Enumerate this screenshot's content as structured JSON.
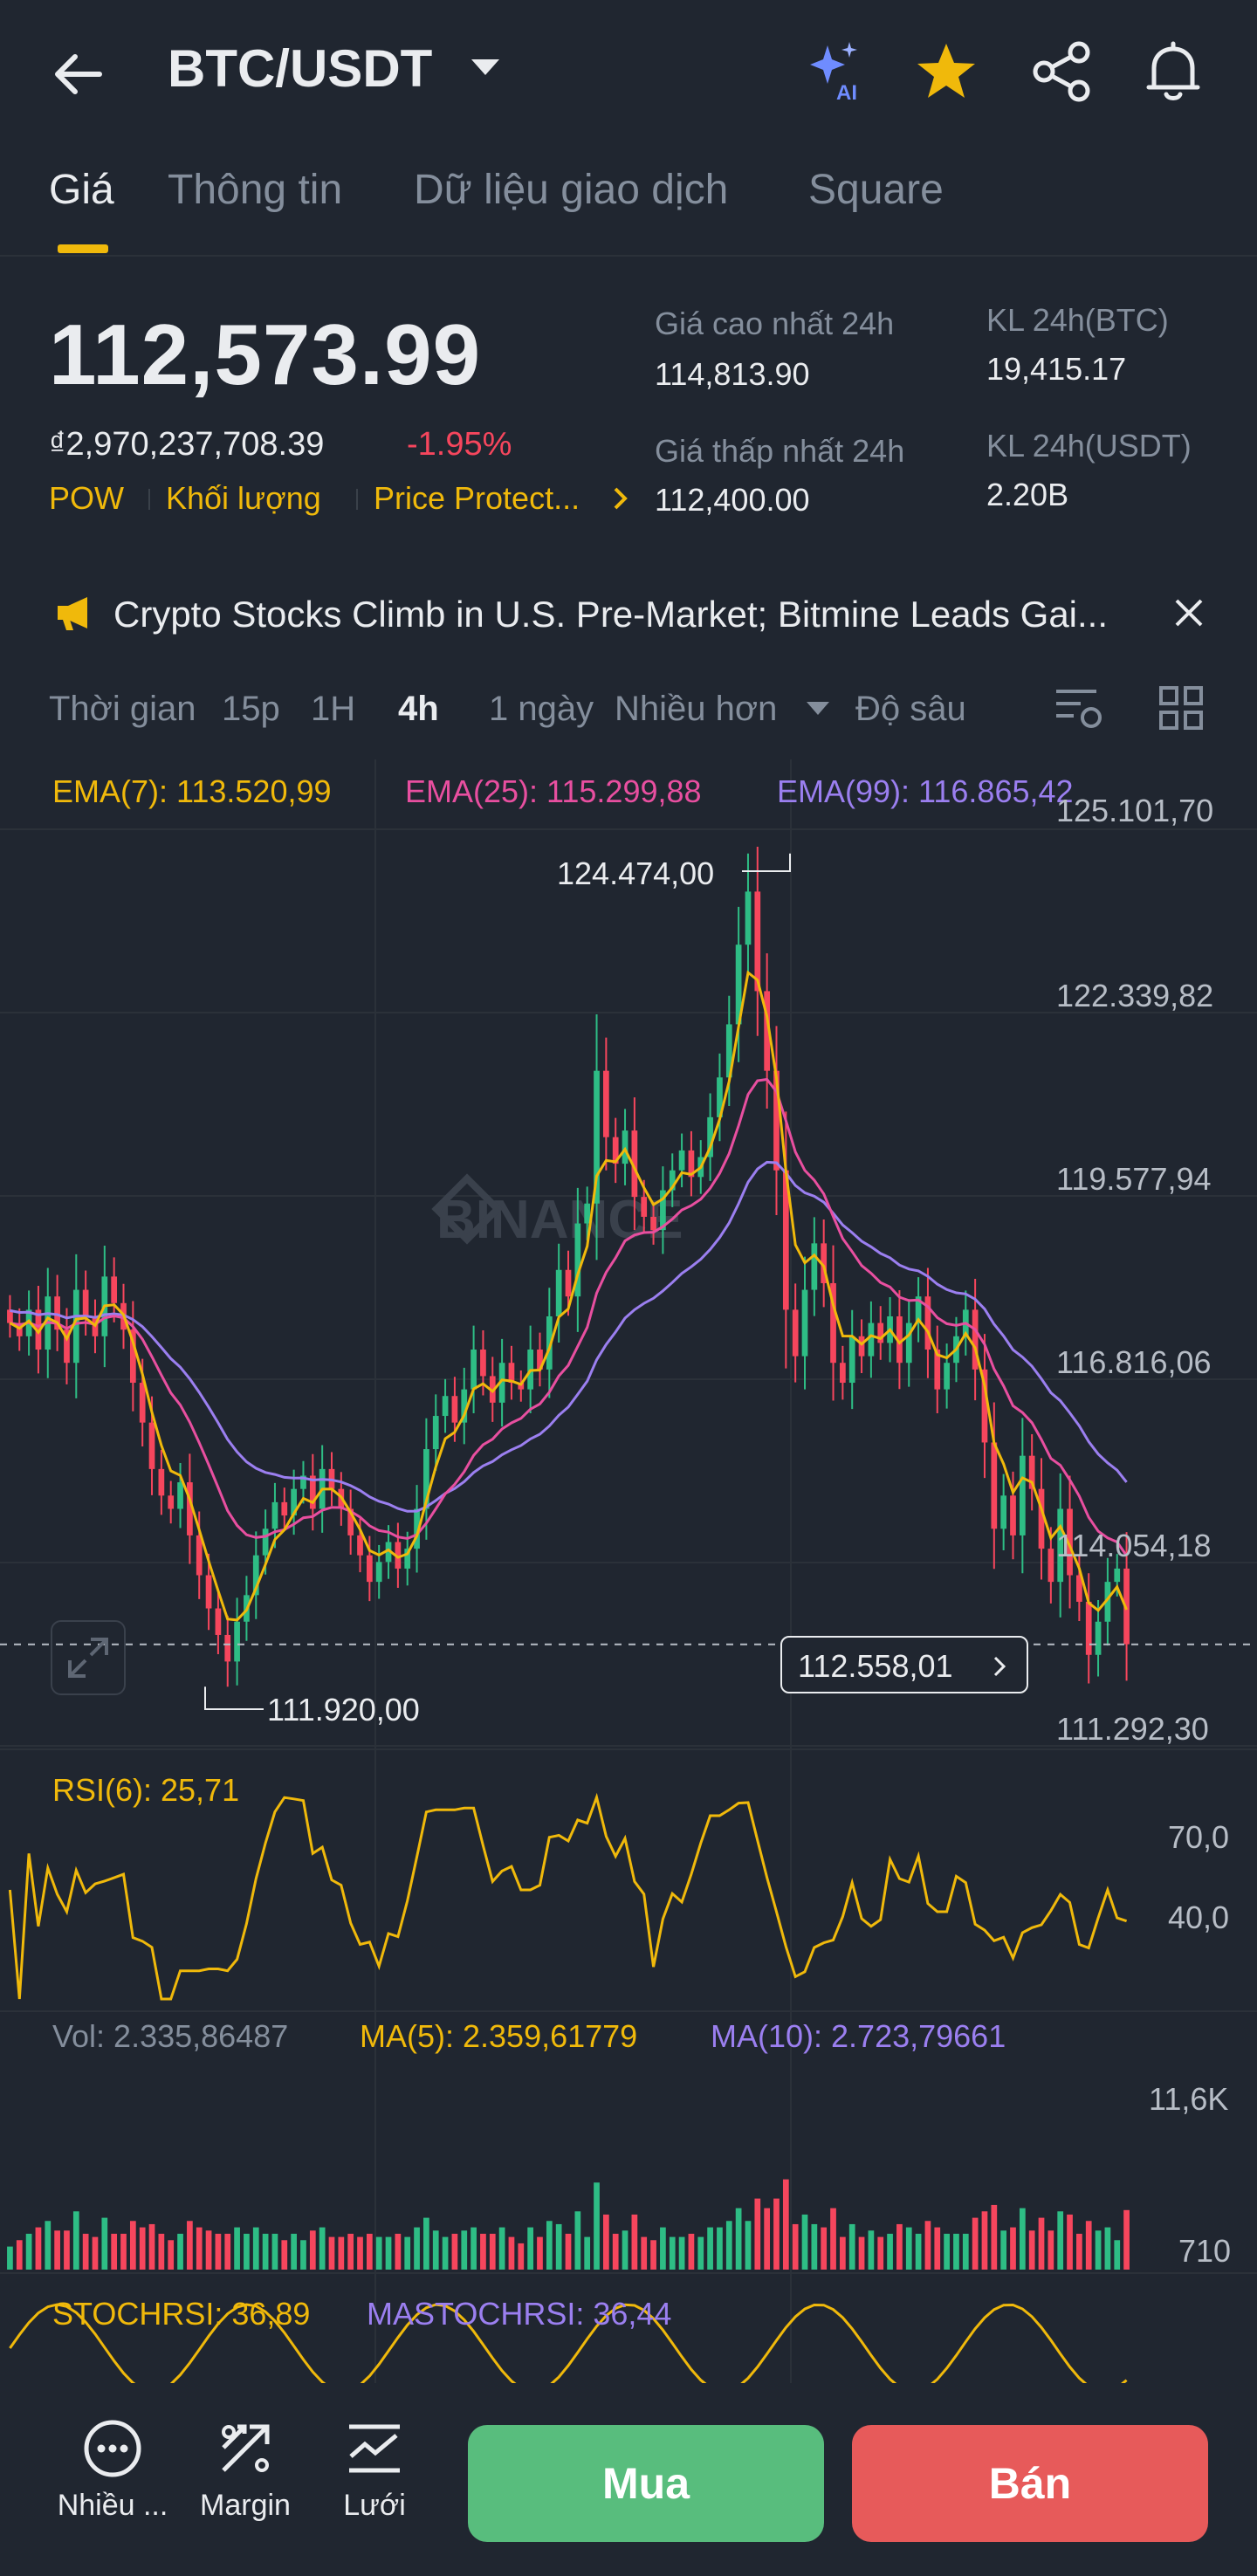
{
  "header": {
    "pair": "BTC/USDT",
    "ai_badge": "AI",
    "icons": [
      "back-arrow-icon",
      "chevron-down-icon",
      "ai-sparkle-icon",
      "star-icon",
      "share-icon",
      "bell-icon"
    ]
  },
  "tabs": [
    {
      "label": "Giá",
      "active": true
    },
    {
      "label": "Thông tin",
      "active": false
    },
    {
      "label": "Dữ liệu giao dịch",
      "active": false
    },
    {
      "label": "Square",
      "active": false
    }
  ],
  "price": {
    "last": "112,573.99",
    "fiat": "₫2,970,237,708.39",
    "change": "-1.95%",
    "tags": [
      "POW",
      "Khối lượng",
      "Price Protect..."
    ]
  },
  "stats": {
    "high_label": "Giá cao nhất 24h",
    "high_value": "114,813.90",
    "low_label": "Giá thấp nhất 24h",
    "low_value": "112,400.00",
    "vol_btc_label": "KL 24h(BTC)",
    "vol_btc_value": "19,415.17",
    "vol_usdt_label": "KL 24h(USDT)",
    "vol_usdt_value": "2.20B"
  },
  "news": {
    "text": "Crypto Stocks Climb in U.S. Pre-Market; Bitmine Leads Gai..."
  },
  "intervals": {
    "time_label": "Thời gian",
    "options": [
      "15p",
      "1H",
      "4h",
      "1 ngày"
    ],
    "active": "4h",
    "more": "Nhiều hơn",
    "depth": "Độ sâu"
  },
  "colors": {
    "up": "#2ebd85",
    "down": "#f6465d",
    "accent": "#f0b90b",
    "ema7": "#f0b90b",
    "ema25": "#e84fa0",
    "ema99": "#9b7ff0",
    "background": "#202630"
  },
  "chart_data": {
    "type": "candlestick",
    "watermark": "BINANCE",
    "indicators": {
      "ema7": "EMA(7): 113.520,99",
      "ema25": "EMA(25): 115.299,88",
      "ema99": "EMA(99): 116.865,42"
    },
    "y_ticks": [
      "125.101,70",
      "122.339,82",
      "119.577,94",
      "116.816,06",
      "114.054,18",
      "111.292,30"
    ],
    "ylim": [
      111292.3,
      125101.7
    ],
    "high_label": "124.474,00",
    "low_label": "111.920,00",
    "current_price_label": "112.558,01",
    "closes": [
      117400,
      117200,
      117600,
      117000,
      117800,
      117300,
      116800,
      117900,
      117500,
      117200,
      118100,
      117700,
      117300,
      116500,
      115900,
      115200,
      114800,
      114600,
      115000,
      114200,
      113600,
      113100,
      112700,
      112300,
      112900,
      113300,
      113900,
      114300,
      114700,
      114500,
      114900,
      115100,
      114600,
      115200,
      114900,
      114600,
      114200,
      113900,
      113500,
      113800,
      114100,
      113700,
      114000,
      114600,
      115500,
      116000,
      116300,
      115900,
      116400,
      117000,
      116600,
      116200,
      116800,
      116500,
      116400,
      117000,
      116700,
      117500,
      118200,
      117800,
      118900,
      119200,
      121200,
      120200,
      119800,
      120300,
      119300,
      119000,
      118800,
      119400,
      119700,
      120000,
      119600,
      119900,
      120500,
      121100,
      121900,
      123100,
      123900,
      122400,
      121200,
      119700,
      117600,
      116900,
      117900,
      118600,
      118000,
      116800,
      116500,
      117200,
      116900,
      117400,
      117100,
      117500,
      116800,
      117400,
      117800,
      117000,
      116400,
      116800,
      117200,
      117600,
      116700,
      115600,
      114300,
      114800,
      114200,
      115400,
      114900,
      114000,
      113500,
      114600,
      113600,
      113200,
      112400,
      112900,
      113500,
      113700,
      112560
    ],
    "rsi": {
      "label": "RSI(6): 25,71",
      "ticks": [
        "70,0",
        "40,0"
      ]
    },
    "volume": {
      "label": "Vol: 2.335,86487",
      "ma5": "MA(5): 2.359,61779",
      "ma10": "MA(10): 2.723,79661",
      "ticks": [
        "11,6K",
        "710"
      ]
    },
    "stochrsi": {
      "label": "STOCHRSI: 36,89",
      "ma": "MASTOCHRSI: 36,44"
    }
  },
  "bottom_bar": {
    "more": "Nhiều ...",
    "margin": "Margin",
    "grid": "Lưới",
    "buy": "Mua",
    "sell": "Bán"
  }
}
